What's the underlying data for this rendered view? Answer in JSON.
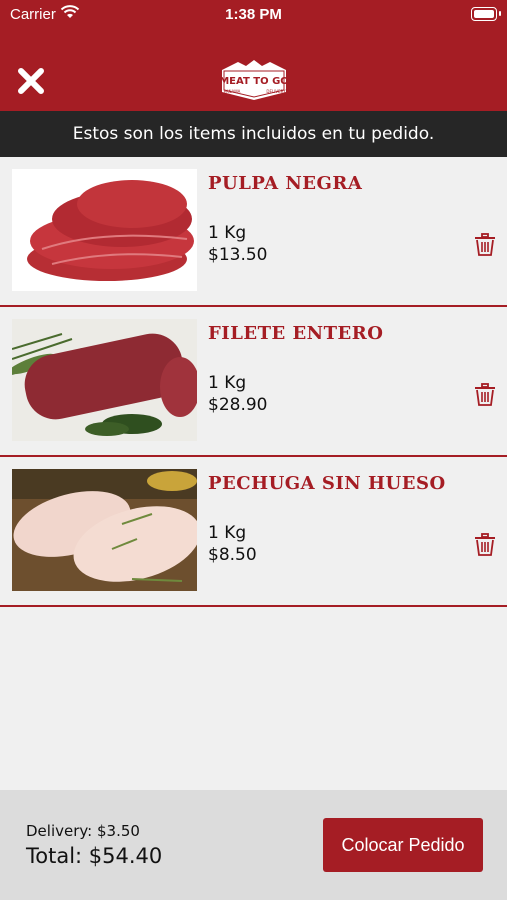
{
  "status_bar": {
    "carrier": "Carrier",
    "time": "1:38 PM",
    "wifi_icon": "wifi-icon",
    "battery_icon": "battery-icon"
  },
  "header": {
    "close_icon": "close-icon",
    "logo_text": "MEAT TO GO",
    "logo_left": "PANAMA",
    "logo_right": "DELIVERY",
    "brand_color": "#a51d24"
  },
  "banner": {
    "text": "Estos son los items incluidos en tu pedido."
  },
  "items": [
    {
      "name": "PULPA NEGRA",
      "qty": "1 Kg",
      "price": "$13.50"
    },
    {
      "name": "FILETE ENTERO",
      "qty": "1 Kg",
      "price": "$28.90"
    },
    {
      "name": "PECHUGA SIN HUESO",
      "qty": "1 Kg",
      "price": "$8.50"
    }
  ],
  "footer": {
    "delivery": "Delivery: $3.50",
    "total": "Total: $54.40",
    "button_label": "Colocar Pedido"
  }
}
